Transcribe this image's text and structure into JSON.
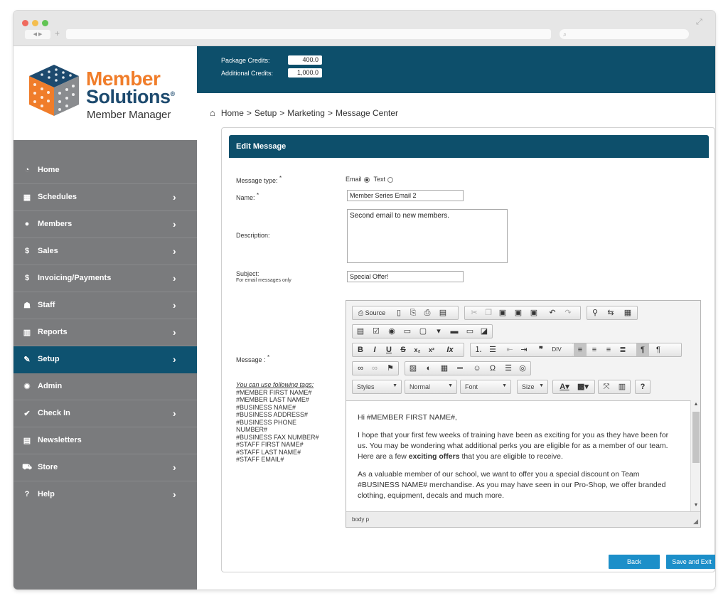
{
  "brand": {
    "line1": "Member",
    "line2": "Solutions",
    "registered": "®",
    "line3": "Member Manager",
    "colors": {
      "orange": "#f07d2a",
      "navy": "#1d4a6e",
      "header": "#0d4f6b",
      "sidebar": "#7a7b7d"
    }
  },
  "browser": {
    "back_forward": "◀ ▶",
    "new_tab": "+",
    "search_icon": "⌕"
  },
  "credits": {
    "package_label": "Package Credits:",
    "package_value": "400.0",
    "additional_label": "Additional Credits:",
    "additional_value": "1,000.0"
  },
  "sidebar": {
    "items": [
      {
        "label": "Home",
        "icon": "dashboard-icon"
      },
      {
        "label": "Schedules",
        "icon": "calendar-icon"
      },
      {
        "label": "Members",
        "icon": "user-icon"
      },
      {
        "label": "Sales",
        "icon": "dollar-icon"
      },
      {
        "label": "Invoicing/Payments",
        "icon": "dollar-icon"
      },
      {
        "label": "Staff",
        "icon": "users-icon"
      },
      {
        "label": "Reports",
        "icon": "bar-chart-icon"
      },
      {
        "label": "Setup",
        "icon": "wrench-icon",
        "active": true
      },
      {
        "label": "Admin",
        "icon": "gear-icon"
      },
      {
        "label": "Check In",
        "icon": "check-circle-icon"
      },
      {
        "label": "Newsletters",
        "icon": "newspaper-icon"
      },
      {
        "label": "Store",
        "icon": "cart-icon"
      },
      {
        "label": "Help",
        "icon": "question-circle-icon"
      }
    ]
  },
  "breadcrumb": {
    "items": [
      "Home",
      "Setup",
      "Marketing",
      "Message Center"
    ],
    "separator": ">"
  },
  "form": {
    "panel_title": "Edit Message",
    "message_type_label": "Message type:",
    "required_mark": "*",
    "type_email": "Email",
    "type_text": "Text",
    "selected_type": "Email",
    "name_label": "Name:",
    "name_value": "Member Series Email 2",
    "description_label": "Description:",
    "description_value": "Second email to new members.",
    "subject_label": "Subject:",
    "subject_note": "For email messages only",
    "subject_value": "Special Offer!",
    "message_label": "Message :",
    "tags_title": "You can use following tags:",
    "tags": [
      "#MEMBER FIRST NAME#",
      "#MEMBER LAST NAME#",
      "#BUSINESS NAME#",
      "#BUSINESS ADDRESS#",
      "#BUSINESS PHONE",
      "NUMBER#",
      "#BUSINESS FAX NUMBER#",
      "#STAFF FIRST NAME#",
      "#STAFF LAST NAME#",
      "#STAFF EMAIL#"
    ]
  },
  "editor": {
    "source_label": "Source",
    "styles_label": "Styles",
    "format_label": "Normal",
    "font_label": "Font",
    "size_label": "Size",
    "help_label": "?",
    "greeting": "Hi #MEMBER FIRST NAME#,",
    "para1_before": "I hope that your first few weeks of training have been as exciting for you as they have been for us.  You may be wondering what additional perks you are eligible for as a member of our team.  Here are a few ",
    "para1_bold": "exciting offers",
    "para1_after": " that you are eligible to receive.",
    "para2": "As a valuable member of our school, we want to offer you a special discount on Team #BUSINESS NAME# merchandise.  As you may have seen in our Pro-Shop, we offer branded clothing, equipment, decals and much more.",
    "status_path": "body  p"
  },
  "actions": {
    "back": "Back",
    "save_exit": "Save and Exit"
  }
}
